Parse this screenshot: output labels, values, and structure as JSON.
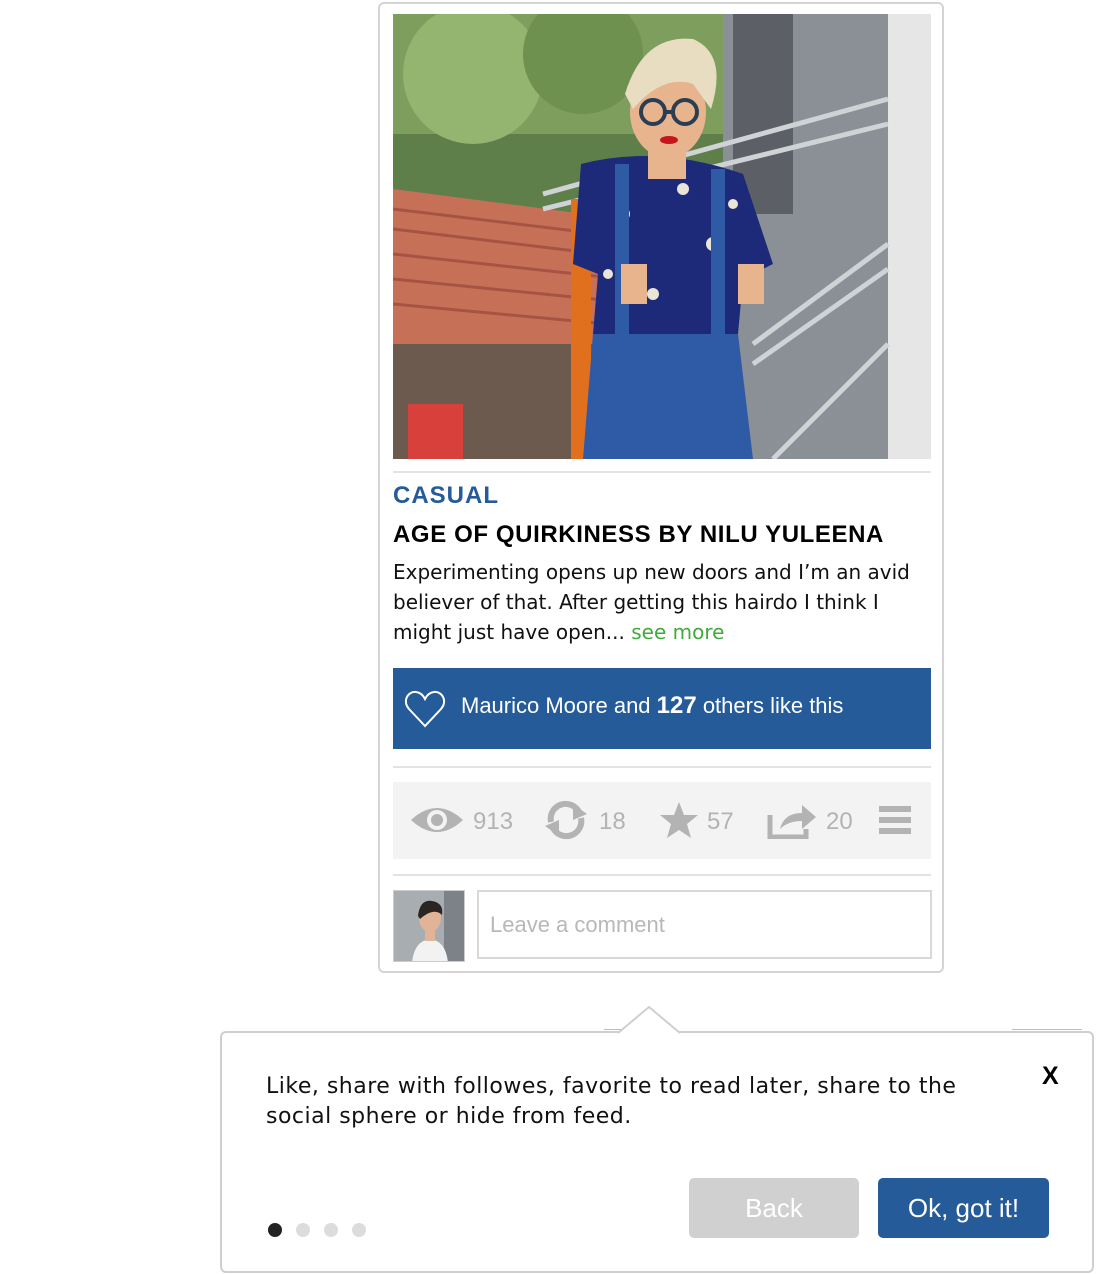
{
  "post": {
    "category": "CASUAL",
    "title": "AGE OF QUIRKINESS BY NILU YULEENA",
    "excerpt": "Experimenting opens up new doors and I’m an avid believer of that. After getting this hairdo I think I might just have open... ",
    "see_more": "see more"
  },
  "likes": {
    "icon": "heart-icon",
    "text_before": "Maurico Moore and ",
    "count": "127",
    "text_after": " others like this"
  },
  "actions": [
    {
      "icon": "eye-icon",
      "count": "913"
    },
    {
      "icon": "repost-icon",
      "count": "18"
    },
    {
      "icon": "star-icon",
      "count": "57"
    },
    {
      "icon": "share-icon",
      "count": "20"
    },
    {
      "icon": "menu-icon"
    }
  ],
  "comment": {
    "placeholder": "Leave a comment"
  },
  "tooltip": {
    "text": "Like, share with followes, favorite to read later, share to the social sphere or hide from feed.",
    "close": "X",
    "back_label": "Back",
    "ok_label": "Ok, got it!",
    "step_current": 1,
    "step_total": 4
  },
  "colors": {
    "brand_blue": "#245b98",
    "link_green": "#3fab3a",
    "icon_gray": "#b3b3b3"
  }
}
